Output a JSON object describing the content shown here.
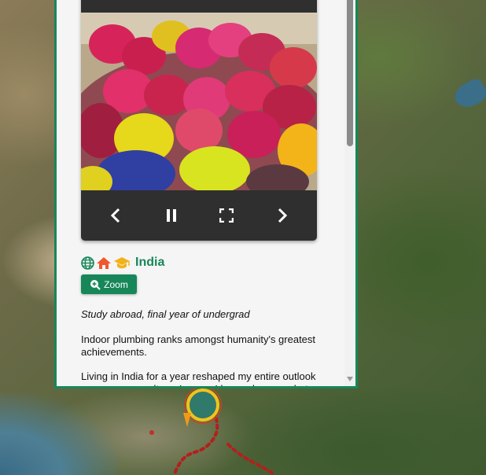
{
  "map": {
    "description_colors": {
      "route": "#c0302a",
      "marker": "#f0c419",
      "panel_accent": "#17875a"
    }
  },
  "gallery": {
    "controls": [
      {
        "name": "previous-button",
        "icon": "chevron-left-icon"
      },
      {
        "name": "pause-button",
        "icon": "pause-icon"
      },
      {
        "name": "fullscreen-button",
        "icon": "fullscreen-icon"
      },
      {
        "name": "next-button",
        "icon": "chevron-right-icon"
      }
    ]
  },
  "place": {
    "icons": [
      "globe-icon",
      "home-icon",
      "graduation-cap-icon"
    ],
    "title": "India",
    "zoom_label": "Zoom",
    "subtitle": "Study abroad, final year of undergrad",
    "paragraph1": "Indoor plumbing ranks amongst humanity's greatest achievements.",
    "paragraph2": "Living in India for a year reshaped my entire outlook on consumer culture. Luxury, I learned, means hot"
  }
}
